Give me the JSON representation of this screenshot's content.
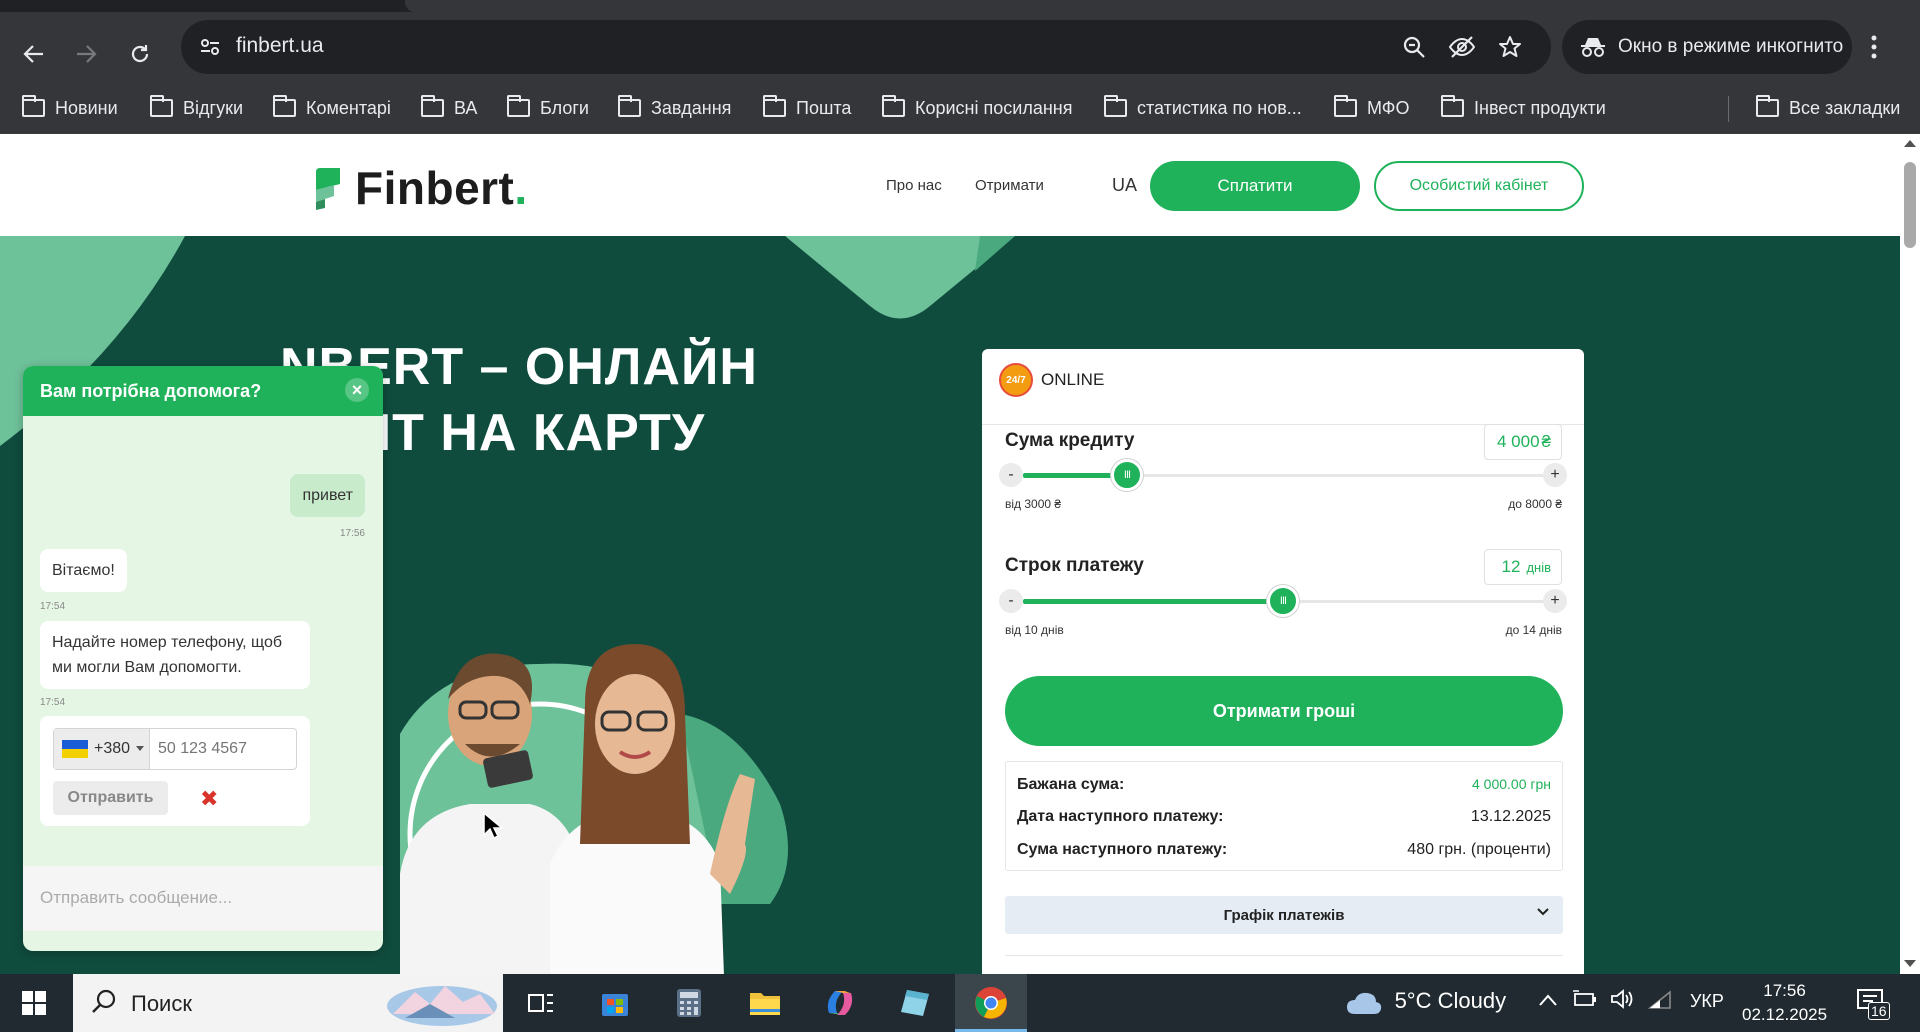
{
  "browser": {
    "url": "finbert.ua",
    "incognito_label": "Окно в режиме инкогнито",
    "bookmarks": [
      "Новини",
      "Відгуки",
      "Коментарі",
      "ВА",
      "Блоги",
      "Завдання",
      "Пошта",
      "Корисні посилання",
      "статистика по нов...",
      "МФО",
      "Інвест продукти"
    ],
    "all_bookmarks": "Все закладки"
  },
  "site": {
    "logo": "Finbert",
    "logo_dot": ".",
    "nav": [
      "Про нас",
      "Отримати"
    ],
    "lang": "UA",
    "pay_button": "Сплатити",
    "cabinet_button": "Особистий кабінет",
    "hero_line1": "NBERT – ОНЛАЙН",
    "hero_line2": "ЕДИТ НА КАРТУ"
  },
  "calculator": {
    "badge_icon_text": "24/7",
    "badge_label": "ONLINE",
    "amount_label": "Сума кредиту",
    "amount_value": "4 000",
    "amount_currency": "₴",
    "amount_min": "від 3000 ₴",
    "amount_max": "до 8000 ₴",
    "amount_fraction": 0.2,
    "term_label": "Строк платежу",
    "term_value": "12",
    "term_unit": "днів",
    "term_min": "від 10 днів",
    "term_max": "до 14 днів",
    "term_fraction": 0.5,
    "minus": "-",
    "plus": "+",
    "thumb_grip": "III",
    "cta": "Отримати гроші",
    "summary": [
      {
        "key": "Бажана сума:",
        "value": "4 000.00 грн",
        "accent": true
      },
      {
        "key": "Дата наступного платежу:",
        "value": "13.12.2025",
        "accent": false
      },
      {
        "key": "Сума наступного платежу:",
        "value": "480 грн. (проценти)",
        "accent": false
      }
    ],
    "schedule": "Графік платежів"
  },
  "chat": {
    "title": "Вам потрібна допомога?",
    "close": "×",
    "msg_user": "привет",
    "msg_user_time": "17:56",
    "msg_bot1": "Вітаємо!",
    "msg_bot1_time": "17:54",
    "msg_bot2": "Надайте номер телефону, щоб ми могли Вам допомогти.",
    "msg_bot2_time": "17:54",
    "phone_code": "+380",
    "phone_placeholder": "50 123 4567",
    "send": "Отправить",
    "cancel": "✖",
    "input_placeholder": "Отправить сообщение..."
  },
  "taskbar": {
    "search_label": "Поиск",
    "weather": "5°C  Cloudy",
    "lang": "УКР",
    "time": "17:56",
    "date": "02.12.2025",
    "notifications": "16"
  },
  "colors": {
    "brand_green": "#1fb25a",
    "hero_dark": "#0f4c3e",
    "hero_light": "#6ec29a"
  }
}
